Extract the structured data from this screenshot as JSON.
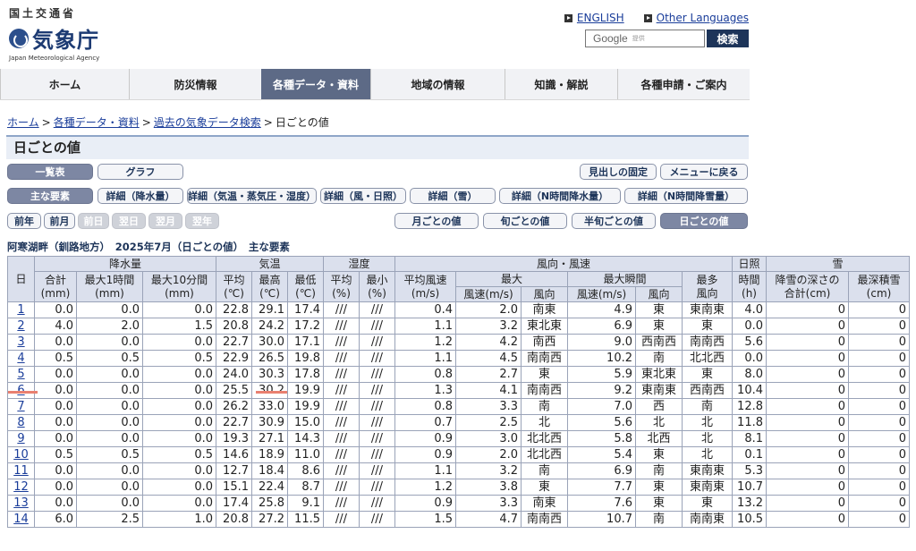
{
  "header": {
    "ministry": "国土交通省",
    "agency": "気象庁",
    "agency_en": "Japan Meteorological Agency",
    "english_link": "ENGLISH",
    "other_languages_link": "Other Languages",
    "search_google": "Google",
    "search_provided": "提供",
    "search_button": "検索"
  },
  "nav": [
    "ホーム",
    "防災情報",
    "各種データ・資料",
    "地域の情報",
    "知識・解説",
    "各種申請・ご案内"
  ],
  "breadcrumb": [
    "ホーム",
    "各種データ・資料",
    "過去の気象データ検索",
    "日ごとの値"
  ],
  "page_title": "日ごとの値",
  "buttons": {
    "list": "一覧表",
    "graph": "グラフ",
    "fix_headings": "見出しの固定",
    "back_to_menu": "メニューに戻る",
    "main_elements": "主な要素",
    "detail_precip": "詳細（降水量）",
    "detail_temp": "詳細（気温・蒸気圧・湿度）",
    "detail_wind": "詳細（風・日照）",
    "detail_snow": "詳細（雪）",
    "detail_nh_precip": "詳細（N時間降水量）",
    "detail_nh_snow": "詳細（N時間降雪量）",
    "prev_year": "前年",
    "prev_month": "前月",
    "prev_day": "前日",
    "next_day": "翌日",
    "next_month": "翌月",
    "next_year": "翌年",
    "monthly": "月ごとの値",
    "ten_day": "旬ごとの値",
    "half_ten_day": "半旬ごとの値",
    "daily": "日ごとの値"
  },
  "caption": "阿寒湖畔（釧路地方）　2025年7月（日ごとの値）　主な要素",
  "table_headers": {
    "day": "日",
    "precip": "降水量",
    "temp": "気温",
    "humidity": "湿度",
    "wind": "風向・風速",
    "sunshine": "日照",
    "snow": "雪",
    "total": "合計",
    "max1h": "最大1時間",
    "max10m": "最大10分間",
    "avg": "平均",
    "high": "最高",
    "low": "最低",
    "min": "最小",
    "avg_wind": "平均風速",
    "max": "最大",
    "max_gust": "最大瞬間",
    "most_freq": "最多",
    "time": "時間",
    "snowfall_depth": "降雪の深さの",
    "total2": "合計(cm)",
    "max_depth": "最深積雪",
    "speed_ms": "風速(m/s)",
    "direction": "風向",
    "dir_only": "風向",
    "unit_mm": "(mm)",
    "unit_c": "(℃)",
    "unit_pct": "(%)",
    "unit_ms": "(m/s)",
    "unit_h": "(h)",
    "unit_cm": "(cm)"
  },
  "rows": [
    [
      "1",
      "0.0",
      "0.0",
      "0.0",
      "22.8",
      "29.1",
      "17.4",
      "///",
      "///",
      "0.4",
      "2.0",
      "南東",
      "4.9",
      "東",
      "東南東",
      "4.0",
      "0",
      "0"
    ],
    [
      "2",
      "4.0",
      "2.0",
      "1.5",
      "20.8",
      "24.2",
      "17.2",
      "///",
      "///",
      "1.1",
      "3.2",
      "東北東",
      "6.9",
      "東",
      "東",
      "0.0",
      "0",
      "0"
    ],
    [
      "3",
      "0.0",
      "0.0",
      "0.0",
      "22.7",
      "30.0",
      "17.1",
      "///",
      "///",
      "1.2",
      "4.2",
      "南西",
      "9.0",
      "西南西",
      "南南西",
      "5.6",
      "0",
      "0"
    ],
    [
      "4",
      "0.5",
      "0.5",
      "0.5",
      "22.9",
      "26.5",
      "19.8",
      "///",
      "///",
      "1.1",
      "4.5",
      "南南西",
      "10.2",
      "南",
      "北北西",
      "0.0",
      "0",
      "0"
    ],
    [
      "5",
      "0.0",
      "0.0",
      "0.0",
      "24.0",
      "30.3",
      "17.8",
      "///",
      "///",
      "0.8",
      "2.7",
      "東",
      "5.9",
      "東北東",
      "東",
      "8.0",
      "0",
      "0"
    ],
    [
      "6",
      "0.0",
      "0.0",
      "0.0",
      "25.5",
      "30.2",
      "19.9",
      "///",
      "///",
      "1.3",
      "4.1",
      "南南西",
      "9.2",
      "東南東",
      "西南西",
      "10.4",
      "0",
      "0"
    ],
    [
      "7",
      "0.0",
      "0.0",
      "0.0",
      "26.2",
      "33.0",
      "19.9",
      "///",
      "///",
      "0.8",
      "3.3",
      "南",
      "7.0",
      "西",
      "南",
      "12.8",
      "0",
      "0"
    ],
    [
      "8",
      "0.0",
      "0.0",
      "0.0",
      "22.7",
      "30.9",
      "15.0",
      "///",
      "///",
      "0.7",
      "2.5",
      "北",
      "5.6",
      "北",
      "北",
      "11.8",
      "0",
      "0"
    ],
    [
      "9",
      "0.0",
      "0.0",
      "0.0",
      "19.3",
      "27.1",
      "14.3",
      "///",
      "///",
      "0.9",
      "3.0",
      "北北西",
      "5.8",
      "北西",
      "北",
      "8.1",
      "0",
      "0"
    ],
    [
      "10",
      "0.5",
      "0.5",
      "0.5",
      "14.6",
      "18.9",
      "11.0",
      "///",
      "///",
      "0.9",
      "2.0",
      "北北西",
      "5.4",
      "東",
      "北",
      "0.1",
      "0",
      "0"
    ],
    [
      "11",
      "0.0",
      "0.0",
      "0.0",
      "12.7",
      "18.4",
      "8.6",
      "///",
      "///",
      "1.1",
      "3.2",
      "南",
      "6.9",
      "南",
      "東南東",
      "5.3",
      "0",
      "0"
    ],
    [
      "12",
      "0.0",
      "0.0",
      "0.0",
      "15.1",
      "22.4",
      "8.7",
      "///",
      "///",
      "1.2",
      "3.8",
      "東",
      "7.7",
      "東",
      "東南東",
      "10.7",
      "0",
      "0"
    ],
    [
      "13",
      "0.0",
      "0.0",
      "0.0",
      "17.4",
      "25.8",
      "9.1",
      "///",
      "///",
      "0.9",
      "3.3",
      "南東",
      "7.6",
      "東",
      "東",
      "13.2",
      "0",
      "0"
    ],
    [
      "14",
      "6.0",
      "2.5",
      "1.0",
      "20.8",
      "27.2",
      "11.5",
      "///",
      "///",
      "1.5",
      "4.7",
      "南南西",
      "10.7",
      "南",
      "南南東",
      "10.5",
      "0",
      "0"
    ]
  ],
  "colors": {
    "nav_active": "#5d6a86",
    "header_cell": "#dbe0ed",
    "link": "#1a3d9a",
    "highlight_mark": "#e98070"
  }
}
